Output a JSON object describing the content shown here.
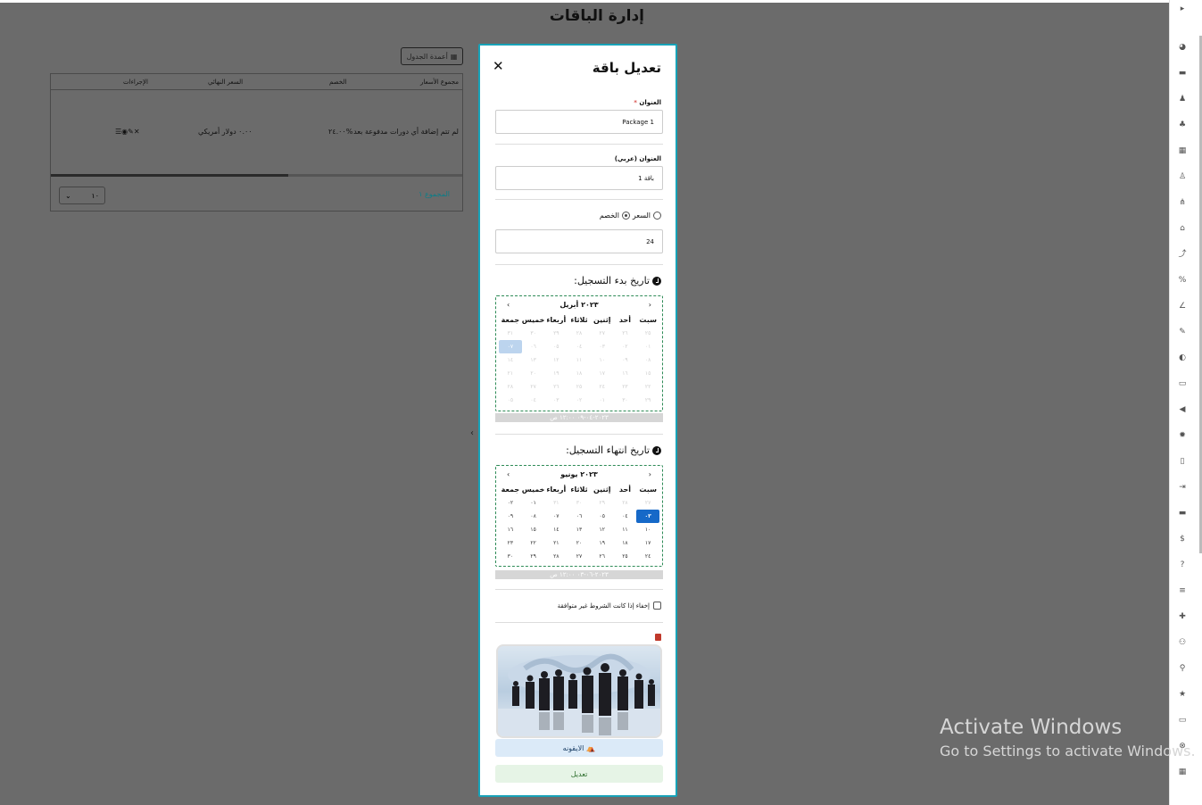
{
  "page": {
    "title": "إدارة الباقات",
    "columns_button": "أعمدة الجدول",
    "table": {
      "headers": [
        "مجموع الأسعار",
        "الخصم",
        "السعر النهائي",
        "الإجراءات"
      ],
      "row": {
        "sum_prices": "لم تتم إضافة أي دورات مدفوعة بعد",
        "discount": "٢٤.٠٠%",
        "final_price": "٠.٠٠ دولار أمريكي",
        "actions": "☰◉✎✕"
      },
      "page_size": "١٠",
      "total": "المجموع ١"
    }
  },
  "modal": {
    "title": "تعديل باقة",
    "close": "✕",
    "title_label": "العنوان",
    "title_required": "*",
    "title_value": "Package 1",
    "title_ar_label": "العنوان (عربي)",
    "title_ar_value": "باقة 1",
    "radio_price": "السعر",
    "radio_discount": "الخصم",
    "amount_value": "24",
    "start_label": "تاريخ بدء التسجيل:",
    "start_cal": {
      "prev": "‹",
      "next": "›",
      "month": "٢٠٢٣ أبريل",
      "dow": [
        "سبت",
        "أحد",
        "إثنين",
        "ثلاثاء",
        "أربعاء",
        "خميس",
        "جمعة"
      ],
      "days": [
        "٢٥",
        "٢٦",
        "٢٧",
        "٢٨",
        "٢٩",
        "٣٠",
        "٣١",
        "٠١",
        "٠٢",
        "٠٣",
        "٠٤",
        "٠٥",
        "٠٦",
        "٠٧",
        "٠٨",
        "٠٩",
        "١٠",
        "١١",
        "١٢",
        "١٣",
        "١٤",
        "١٥",
        "١٦",
        "١٧",
        "١٨",
        "١٩",
        "٢٠",
        "٢١",
        "٢٢",
        "٢٣",
        "٢٤",
        "٢٥",
        "٢٦",
        "٢٧",
        "٢٨",
        "٢٩",
        "٣٠",
        "٠١",
        "٠٢",
        "٠٣",
        "٠٤",
        "٠٥"
      ],
      "selected_index": 13,
      "bar": "٢٠٢٣-٠٤-٠٩ ١٢:٠٠ ص"
    },
    "end_label": "تاريخ انتهاء التسجيل:",
    "end_cal": {
      "prev": "‹",
      "next": "›",
      "month": "٢٠٢٣ يونيو",
      "dow": [
        "سبت",
        "أحد",
        "إثنين",
        "ثلاثاء",
        "أربعاء",
        "خميس",
        "جمعة"
      ],
      "days": [
        "٢٧",
        "٢٨",
        "٢٩",
        "٣٠",
        "٣١",
        "٠١",
        "٠٢",
        "٠٣",
        "٠٤",
        "٠٥",
        "٠٦",
        "٠٧",
        "٠٨",
        "٠٩",
        "١٠",
        "١١",
        "١٢",
        "١٣",
        "١٤",
        "١٥",
        "١٦",
        "١٧",
        "١٨",
        "١٩",
        "٢٠",
        "٢١",
        "٢٢",
        "٢٣",
        "٢٤",
        "٢٥",
        "٢٦",
        "٢٧",
        "٢٨",
        "٢٩",
        "٣٠"
      ],
      "selected_index": 7,
      "dim_count": 5,
      "bar": "٢٠٢٣-٠٦-٠٣ ١٢:٠٠ ص"
    },
    "hide_checkbox_label": "إخفاء إذا كانت الشروط غير متوافقة",
    "icon_button": "الايقونه",
    "save_button": "تعديل"
  },
  "windows": {
    "line1": "Activate Windows",
    "line2": "Go to Settings to activate Windows."
  },
  "sidebar_icons": [
    "chevron-right-icon",
    "dashboard-icon",
    "book-icon",
    "person-icon",
    "users-icon",
    "grid-icon",
    "user-tie-icon",
    "sitemap-icon",
    "bank-icon",
    "upload-icon",
    "percent-icon",
    "chart-icon",
    "pencil-icon",
    "palette-icon",
    "ad-icon",
    "megaphone-icon",
    "gear-icon",
    "file-icon",
    "login-icon",
    "card-icon",
    "dollar-icon",
    "question-icon",
    "list-icon",
    "puzzle-icon",
    "handshake-icon",
    "location-icon",
    "star-icon",
    "ticket-icon",
    "support-icon",
    "calendar-icon"
  ]
}
